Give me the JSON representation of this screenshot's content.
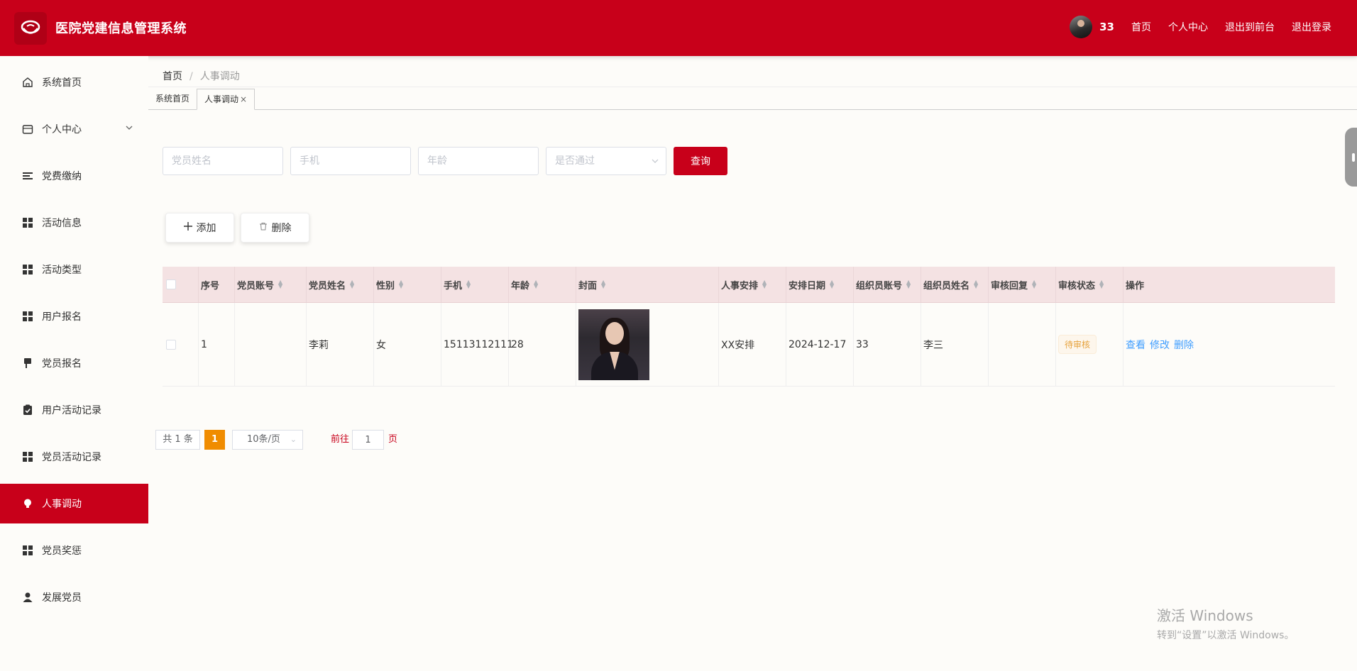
{
  "header": {
    "title": "医院党建信息管理系统",
    "user_name": "33",
    "links": [
      "首页",
      "个人中心",
      "退出到前台",
      "退出登录"
    ]
  },
  "sidebar": {
    "items": [
      {
        "label": "系统首页",
        "icon": "home-icon"
      },
      {
        "label": "个人中心",
        "icon": "wallet-icon"
      },
      {
        "label": "党费缴纳",
        "icon": "list-icon"
      },
      {
        "label": "活动信息",
        "icon": "grid-icon"
      },
      {
        "label": "活动类型",
        "icon": "grid-icon"
      },
      {
        "label": "用户报名",
        "icon": "grid-icon"
      },
      {
        "label": "党员报名",
        "icon": "flag-icon"
      },
      {
        "label": "用户活动记录",
        "icon": "clipboard-check-icon"
      },
      {
        "label": "党员活动记录",
        "icon": "grid-icon"
      },
      {
        "label": "人事调动",
        "icon": "bulb-icon"
      },
      {
        "label": "党员奖惩",
        "icon": "grid-icon"
      },
      {
        "label": "发展党员",
        "icon": "user-icon"
      }
    ],
    "active_index": 9
  },
  "breadcrumb": {
    "home": "首页",
    "current": "人事调动"
  },
  "tabs": [
    {
      "label": "系统首页",
      "active": false
    },
    {
      "label": "人事调动",
      "active": true,
      "close": "×"
    }
  ],
  "search": {
    "name_placeholder": "党员姓名",
    "phone_placeholder": "手机",
    "age_placeholder": "年龄",
    "pass_placeholder": "是否通过",
    "query_label": "查询"
  },
  "actions": {
    "add_label": "添加",
    "delete_label": "删除"
  },
  "table": {
    "headers": [
      "序号",
      "党员账号",
      "党员姓名",
      "性别",
      "手机",
      "年龄",
      "封面",
      "人事安排",
      "安排日期",
      "组织员账号",
      "组织员姓名",
      "审核回复",
      "审核状态",
      "操作"
    ],
    "rows": [
      {
        "index": "1",
        "account": "",
        "name": "李莉",
        "gender": "女",
        "phone": "15113112111",
        "age": "28",
        "arrangement": "XX安排",
        "date": "2024-12-17",
        "org_account": "33",
        "org_name": "李三",
        "reply": "",
        "status": "待审核",
        "ops": [
          "查看",
          "修改",
          "删除"
        ]
      }
    ]
  },
  "pagination": {
    "total": "共 1 条",
    "current_page": "1",
    "page_size": "10条/页",
    "goto_label": "前往",
    "goto_value": "1",
    "goto_suffix": "页"
  },
  "watermark": {
    "line1": "激活 Windows",
    "line2": "转到“设置”以激活 Windows。"
  },
  "colors": {
    "primary": "#c8001a",
    "page_active": "#f08c00",
    "link": "#409eff",
    "warning": "#e6a23c"
  }
}
